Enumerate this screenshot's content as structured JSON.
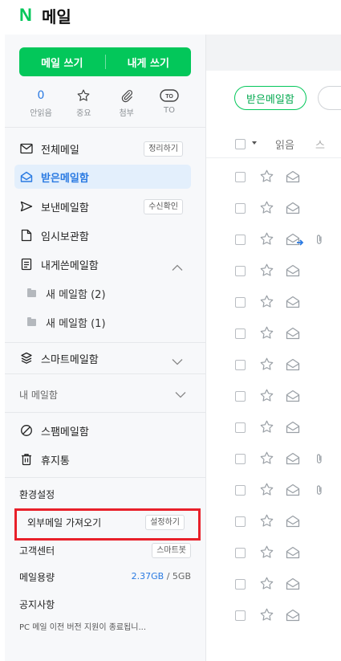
{
  "header": {
    "logo": "N",
    "title": "메일"
  },
  "sidebar": {
    "compose": {
      "write": "메일 쓰기",
      "write_self": "내게 쓰기"
    },
    "quick": [
      {
        "value": "0",
        "label": "안읽음",
        "icon": "unread-count"
      },
      {
        "label": "중요",
        "icon": "star-icon"
      },
      {
        "label": "첨부",
        "icon": "paperclip-icon"
      },
      {
        "label": "TO",
        "icon": "to-icon",
        "icon_text": "TO"
      }
    ],
    "folders": [
      {
        "label": "전체메일",
        "tag": "정리하기",
        "icon": "envelope-icon"
      },
      {
        "label": "받은메일함",
        "active": true,
        "icon": "inbox-icon"
      },
      {
        "label": "보낸메일함",
        "tag": "수신확인",
        "icon": "send-icon"
      },
      {
        "label": "임시보관함",
        "icon": "draft-icon"
      },
      {
        "label": "내게쓴메일함",
        "icon": "note-icon",
        "expanded": true
      }
    ],
    "subfolders": [
      {
        "label": "새 메일함 (2)"
      },
      {
        "label": "새 메일함 (1)"
      }
    ],
    "smart": {
      "label": "스마트메일함",
      "icon": "layers-icon"
    },
    "my_mailbox": {
      "label": "내 메일함"
    },
    "spam": {
      "label": "스팸메일함",
      "icon": "block-icon"
    },
    "trash": {
      "label": "휴지통",
      "icon": "trash-icon"
    },
    "settings": {
      "label": "환경설정"
    },
    "import": {
      "label": "외부메일 가져오기",
      "tag": "설정하기"
    },
    "help": {
      "label": "고객센터",
      "tag": "스마트봇"
    },
    "storage": {
      "label": "메일용량",
      "used": "2.37GB",
      "sep": "/",
      "total": "5GB"
    },
    "notice": {
      "label": "공지사항",
      "text": "PC 메일 이전 버전 지원이 종료됩니..."
    },
    "highlight_color": "#e8202a"
  },
  "main": {
    "inbox_filter": "받은메일함",
    "list_header": {
      "read": "읽음",
      "more": "스"
    },
    "rows": [
      {
        "forward": false,
        "attach": false
      },
      {
        "forward": false,
        "attach": false
      },
      {
        "forward": true,
        "attach": true
      },
      {
        "forward": false,
        "attach": false
      },
      {
        "forward": false,
        "attach": false
      },
      {
        "forward": false,
        "attach": false
      },
      {
        "forward": false,
        "attach": false
      },
      {
        "forward": false,
        "attach": false
      },
      {
        "forward": false,
        "attach": false
      },
      {
        "forward": false,
        "attach": true
      },
      {
        "forward": false,
        "attach": true
      },
      {
        "forward": false,
        "attach": false
      },
      {
        "forward": false,
        "attach": false
      },
      {
        "forward": false,
        "attach": false
      },
      {
        "forward": false,
        "attach": false
      }
    ]
  },
  "colors": {
    "brand": "#03c75a",
    "accent": "#2a7ae2",
    "active_bg": "#e3effc"
  }
}
